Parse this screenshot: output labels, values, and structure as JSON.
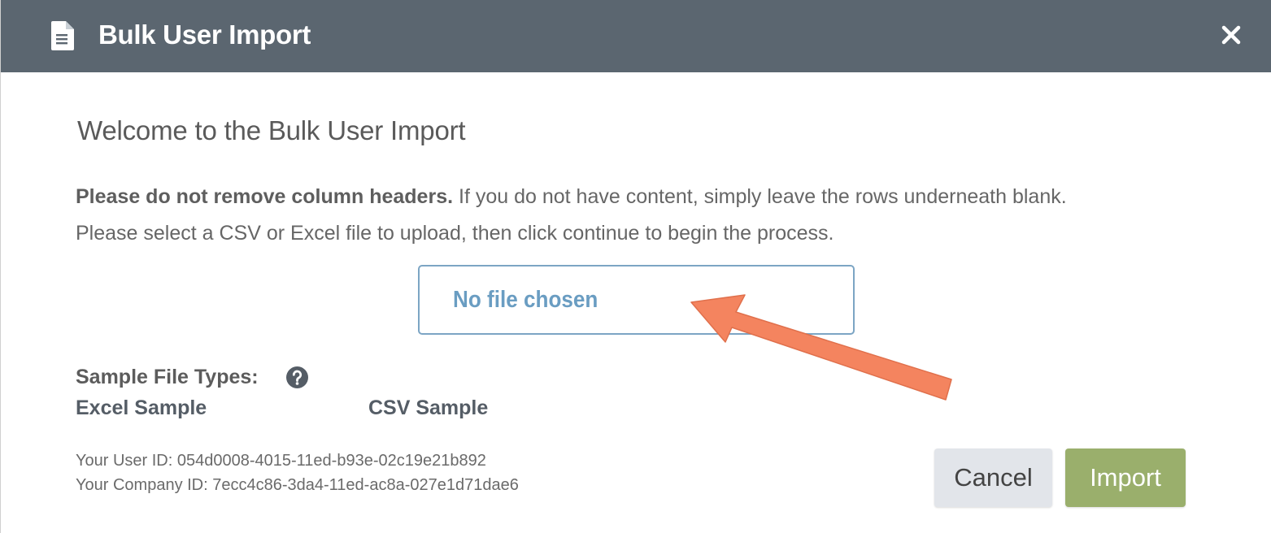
{
  "header": {
    "title": "Bulk User Import",
    "icon": "document-icon",
    "close_icon": "close-icon"
  },
  "main": {
    "welcome_title": "Welcome to the Bulk User Import",
    "instruction_bold": "Please do not remove column headers.",
    "instruction_rest": " If you do not have content, simply leave the rows underneath blank.",
    "instruction_line2": "Please select a CSV or Excel file to upload, then click continue to begin the process.",
    "file_input_label": "No file chosen"
  },
  "samples": {
    "heading": "Sample File Types:",
    "help_icon": "question-circle-icon",
    "excel_label": "Excel Sample",
    "csv_label": "CSV Sample"
  },
  "ids": {
    "user_id": "Your User ID: 054d0008-4015-11ed-b93e-02c19e21b892",
    "company_id": "Your Company ID: 7ecc4c86-3da4-11ed-ac8a-027e1d71dae6"
  },
  "buttons": {
    "cancel": "Cancel",
    "import": "Import"
  },
  "colors": {
    "header_bg": "#5b6670",
    "file_border": "#7ca5c4",
    "file_text": "#6a9dc2",
    "import_bg": "#9aaf6c",
    "cancel_bg": "#e2e5ea",
    "annotation_arrow": "#f4845f"
  },
  "annotation": {
    "arrow_icon": "annotation-arrow"
  }
}
